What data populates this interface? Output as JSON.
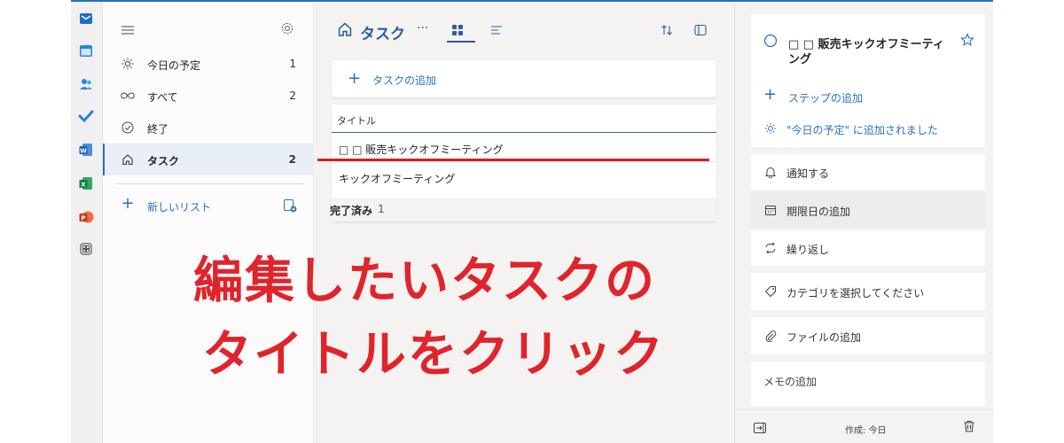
{
  "nav": {
    "items": [
      {
        "label": "今日の予定",
        "count": "1",
        "icon": "sun-icon"
      },
      {
        "label": "すべて",
        "count": "2",
        "icon": "infinity-icon"
      },
      {
        "label": "終了",
        "count": "",
        "icon": "check-circle-icon"
      },
      {
        "label": "タスク",
        "count": "2",
        "icon": "home-icon"
      }
    ],
    "new_list_label": "新しいリスト"
  },
  "main": {
    "title": "タスク",
    "more": "···",
    "add_task_label": "タスクの追加",
    "column_title": "タイトル",
    "rows": [
      "□ □ 販売キックオフミーティング",
      "キックオフミーティング"
    ],
    "completed_label": "完了済み",
    "completed_count": "1"
  },
  "annotation": {
    "line1": "編集したいタスクの",
    "line2": "タイトルをクリック"
  },
  "detail": {
    "title": "□ □ 販売キックオフミーティング",
    "add_step": "ステップの追加",
    "added_today": "\"今日の予定\" に追加されました",
    "remind": "通知する",
    "due_date": "期限日の追加",
    "repeat": "繰り返し",
    "category": "カテゴリを選択してください",
    "add_file": "ファイルの追加",
    "memo": "メモの追加",
    "created": "作成: 今日"
  },
  "colors": {
    "accent": "#2b6fbd",
    "annotation": "#e0242c"
  }
}
